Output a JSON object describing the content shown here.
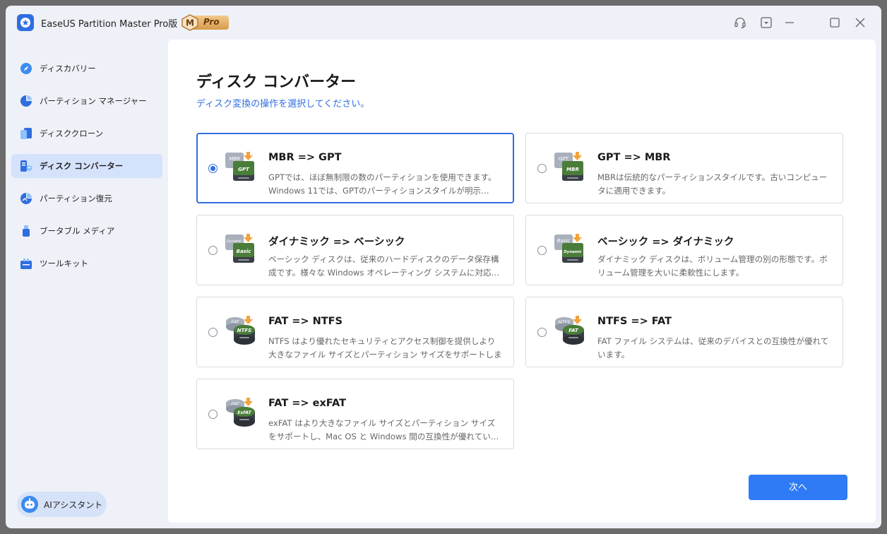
{
  "app": {
    "title": "EaseUS Partition Master Pro版",
    "badge_letter": "M",
    "badge_text": "Pro"
  },
  "titlebar_icons": [
    "headset-icon",
    "dropdown-menu-icon",
    "minimize-icon",
    "maximize-icon",
    "close-icon"
  ],
  "sidebar": {
    "items": [
      {
        "label": "ディスカバリー",
        "icon": "compass-icon"
      },
      {
        "label": "パーティション マネージャー",
        "icon": "pie-chart-icon"
      },
      {
        "label": "ディスククローン",
        "icon": "clone-icon"
      },
      {
        "label": "ディスク コンバーター",
        "icon": "converter-icon",
        "active": true
      },
      {
        "label": "パーティション復元",
        "icon": "recovery-icon"
      },
      {
        "label": "ブータブル メディア",
        "icon": "usb-icon"
      },
      {
        "label": "ツールキット",
        "icon": "toolkit-icon"
      }
    ],
    "ai_assistant": "AIアシスタント"
  },
  "main": {
    "title": "ディスク コンバーター",
    "subtitle": "ディスク変換の操作を選択してください。",
    "options": [
      {
        "title": "MBR => GPT",
        "desc": "GPTでは、ほぼ無制限の数のパーティションを使用できます。Windows 11では、GPTのパーティションスタイルが明示…",
        "selected": true,
        "icon_from": "MBR",
        "icon_to": "GPT"
      },
      {
        "title": "GPT => MBR",
        "desc": "MBRは伝統的なパーティションスタイルです。古いコンピュータに適用できます。",
        "selected": false,
        "icon_from": "GPT",
        "icon_to": "MBR"
      },
      {
        "title": "ダイナミック => ベーシック",
        "desc": "ベーシック ディスクは、従来のハードディスクのデータ保存構成です。様々な Windows オペレーティング システムに対応…",
        "selected": false,
        "icon_from": "Dynamic",
        "icon_to": "Basic"
      },
      {
        "title": "ベーシック => ダイナミック",
        "desc": "ダイナミック ディスクは、ボリューム管理の別の形態です。ボリューム管理を大いに柔軟性にします。",
        "selected": false,
        "icon_from": "Basic",
        "icon_to": "Dynamic"
      },
      {
        "title": "FAT => NTFS",
        "desc": "NTFS はより優れたセキュリティとアクセス制御を提供しより大きなファイル サイズとパーティション サイズをサポートします。",
        "selected": false,
        "icon_from": "FAT",
        "icon_to": "NTFS"
      },
      {
        "title": "NTFS => FAT",
        "desc": "FAT ファイル システムは、従来のデバイスとの互換性が優れています。",
        "selected": false,
        "icon_from": "NTFS",
        "icon_to": "FAT"
      },
      {
        "title": "FAT => exFAT",
        "desc": "exFAT はより大きなファイル サイズとパーティション サイズをサポートし、Mac OS と Windows 間の互換性が優れてい…",
        "selected": false,
        "icon_from": "FAT",
        "icon_to": "ExFAT"
      }
    ],
    "next_button": "次へ"
  },
  "colors": {
    "accent": "#2f6ee0",
    "button": "#2f7bf5",
    "sidebar_bg": "#eef1f7",
    "active_item_bg": "#d5e2fc",
    "arrow_orange": "#f3a33b"
  }
}
